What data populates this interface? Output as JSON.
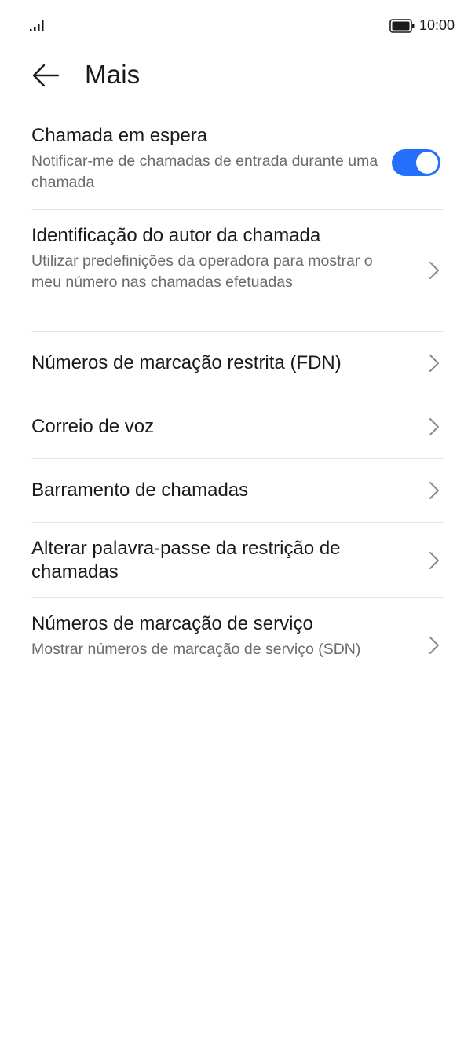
{
  "status_bar": {
    "time": "10:00",
    "signal_icon": "signal-bars-icon",
    "battery_icon": "battery-full-icon"
  },
  "header": {
    "back_icon": "arrow-left-icon",
    "title": "Mais"
  },
  "settings": [
    {
      "title": "Chamada em espera",
      "subtitle": "Notificar-me de chamadas de entrada durante uma chamada",
      "control": "toggle",
      "toggle_on": true
    },
    {
      "title": "Identificação do autor da chamada",
      "subtitle": "Utilizar predefinições da operadora para mostrar o meu número nas chamadas efetuadas",
      "control": "chevron"
    },
    {
      "title": "Números de marcação restrita (FDN)",
      "control": "chevron"
    },
    {
      "title": "Correio de voz",
      "control": "chevron"
    },
    {
      "title": "Barramento de chamadas",
      "control": "chevron"
    },
    {
      "title": "Alterar palavra-passe da restrição de chamadas",
      "control": "chevron"
    },
    {
      "title": "Números de marcação de serviço",
      "subtitle": "Mostrar números de marcação de serviço (SDN)",
      "control": "chevron"
    }
  ],
  "colors": {
    "accent": "#256fff",
    "text_primary": "#1a1a1a",
    "text_secondary": "#6b6b6b",
    "divider": "#e5e5e5"
  }
}
